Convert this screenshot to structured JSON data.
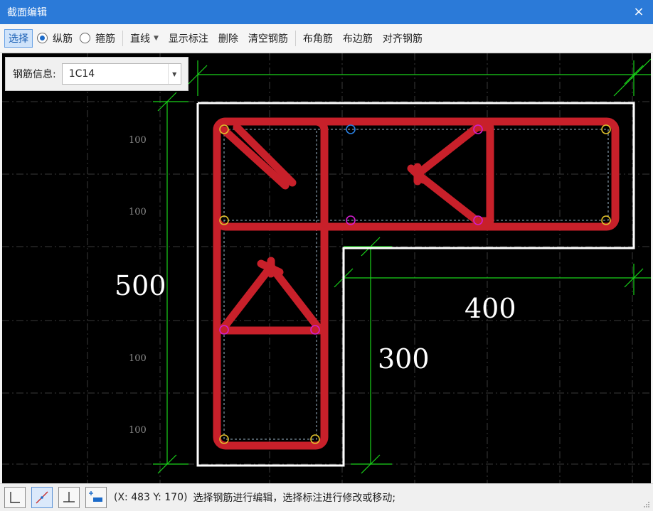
{
  "window": {
    "title": "截面编辑",
    "close_glyph": "×"
  },
  "toolbar": {
    "select": "选择",
    "radio_longitudinal": "纵筋",
    "radio_stirrup": "箍筋",
    "line_mode": "直线",
    "show_dimension": "显示标注",
    "delete": "删除",
    "clear_rebar": "清空钢筋",
    "corner_rebar": "布角筋",
    "edge_rebar": "布边筋",
    "align_rebar": "对齐钢筋",
    "selected_radio": "纵筋"
  },
  "info_panel": {
    "label": "钢筋信息:",
    "value": "1C14"
  },
  "drawing": {
    "dims": {
      "d500": "500",
      "d400": "400",
      "d300": "300"
    },
    "grid_labels": [
      "100",
      "100",
      "100",
      "100"
    ],
    "colors": {
      "rebar": "#c8202a",
      "outline": "#ffffff",
      "dimension": "#19d219",
      "grid": "#3a3a3a",
      "bar_yellow": "#e0c12a",
      "bar_magenta": "#d21ecf",
      "bar_blue": "#2a7fe0"
    }
  },
  "statusbar": {
    "coords": "(X: 483 Y: 170)",
    "message": "选择钢筋进行编辑，选择标注进行修改或移动;"
  }
}
